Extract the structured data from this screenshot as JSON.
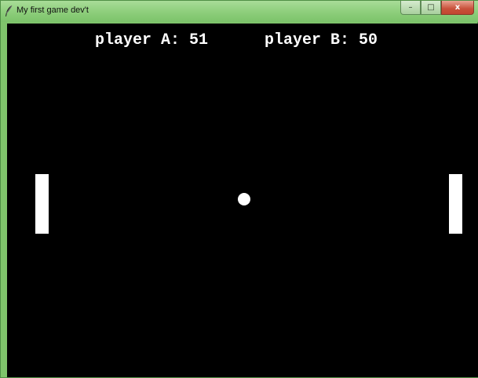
{
  "window": {
    "title": "My first game dev't",
    "icon": "feather-icon",
    "controls": {
      "minimize_icon": "–",
      "maximize_icon": "□",
      "close_icon": "x"
    }
  },
  "game": {
    "score_a_text": "player A: 51",
    "score_b_text": "player B: 50",
    "colors": {
      "background": "#000000",
      "foreground": "#ffffff",
      "window_frame": "#7fc46b"
    }
  }
}
